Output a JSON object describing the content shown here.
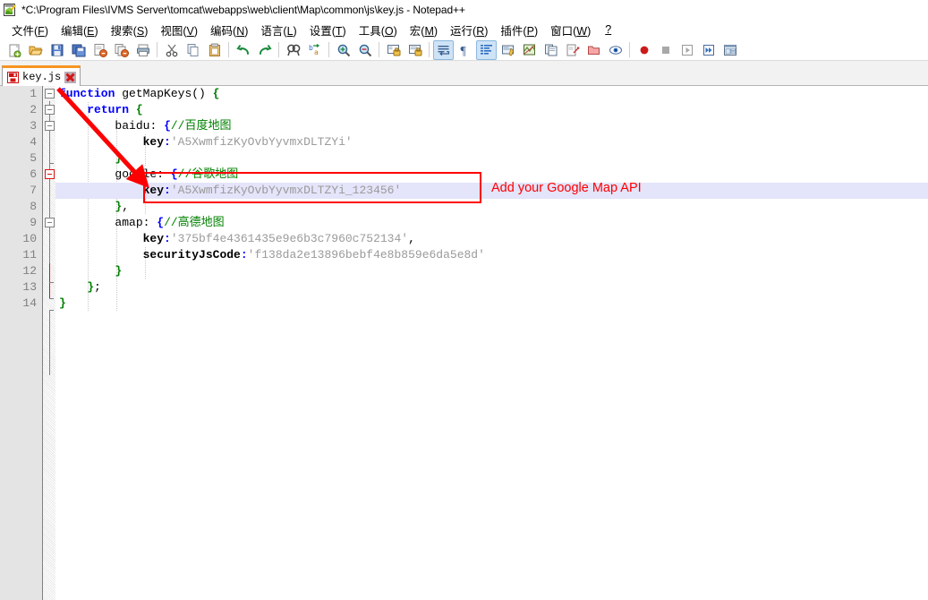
{
  "window": {
    "title": "*C:\\Program Files\\IVMS Server\\tomcat\\webapps\\web\\client\\Map\\common\\js\\key.js - Notepad++",
    "app_icon": "notepad-plus-plus-icon"
  },
  "menubar": {
    "items": [
      {
        "label": "文件(F)",
        "name": "menu-file"
      },
      {
        "label": "编辑(E)",
        "name": "menu-edit"
      },
      {
        "label": "搜索(S)",
        "name": "menu-search"
      },
      {
        "label": "视图(V)",
        "name": "menu-view"
      },
      {
        "label": "编码(N)",
        "name": "menu-encoding"
      },
      {
        "label": "语言(L)",
        "name": "menu-language"
      },
      {
        "label": "设置(T)",
        "name": "menu-settings"
      },
      {
        "label": "工具(O)",
        "name": "menu-tools"
      },
      {
        "label": "宏(M)",
        "name": "menu-macro"
      },
      {
        "label": "运行(R)",
        "name": "menu-run"
      },
      {
        "label": "插件(P)",
        "name": "menu-plugins"
      },
      {
        "label": "窗口(W)",
        "name": "menu-window"
      },
      {
        "label": "?",
        "name": "menu-help"
      }
    ]
  },
  "toolbar": {
    "buttons": [
      {
        "icon": "new-file-icon",
        "active": false,
        "sep_after": false
      },
      {
        "icon": "open-file-icon",
        "active": false,
        "sep_after": false
      },
      {
        "icon": "save-icon",
        "active": false,
        "sep_after": false
      },
      {
        "icon": "save-all-icon",
        "active": false,
        "sep_after": false
      },
      {
        "icon": "close-file-icon",
        "active": false,
        "sep_after": false
      },
      {
        "icon": "close-all-files-icon",
        "active": false,
        "sep_after": false
      },
      {
        "icon": "print-icon",
        "active": false,
        "sep_after": true
      },
      {
        "icon": "cut-icon",
        "active": false,
        "sep_after": false
      },
      {
        "icon": "copy-icon",
        "active": false,
        "sep_after": false
      },
      {
        "icon": "paste-icon",
        "active": false,
        "sep_after": true
      },
      {
        "icon": "undo-icon",
        "active": false,
        "sep_after": false
      },
      {
        "icon": "redo-icon",
        "active": false,
        "sep_after": true
      },
      {
        "icon": "find-icon",
        "active": false,
        "sep_after": false
      },
      {
        "icon": "replace-icon",
        "active": false,
        "sep_after": true
      },
      {
        "icon": "zoom-in-icon",
        "active": false,
        "sep_after": false
      },
      {
        "icon": "zoom-out-icon",
        "active": false,
        "sep_after": true
      },
      {
        "icon": "sync-vertical-scroll-icon",
        "active": false,
        "sep_after": false
      },
      {
        "icon": "sync-horizontal-scroll-icon",
        "active": false,
        "sep_after": true
      },
      {
        "icon": "word-wrap-icon",
        "active": true,
        "sep_after": false
      },
      {
        "icon": "show-all-characters-icon",
        "active": false,
        "sep_after": false
      },
      {
        "icon": "indent-guideline-icon",
        "active": true,
        "sep_after": false
      },
      {
        "icon": "user-defined-language-icon",
        "active": false,
        "sep_after": false
      },
      {
        "icon": "document-map-icon",
        "active": false,
        "sep_after": false
      },
      {
        "icon": "function-list-icon",
        "active": false,
        "sep_after": false
      },
      {
        "icon": "file-browser-icon",
        "active": false,
        "sep_after": false
      },
      {
        "icon": "folder-as-workspace-icon",
        "active": false,
        "sep_after": false
      },
      {
        "icon": "monitoring-icon",
        "active": false,
        "sep_after": true
      },
      {
        "icon": "record-macro-icon",
        "active": false,
        "sep_after": false
      },
      {
        "icon": "stop-macro-icon",
        "active": false,
        "sep_after": false
      },
      {
        "icon": "play-macro-icon",
        "active": false,
        "sep_after": false
      },
      {
        "icon": "run-macro-multiple-icon",
        "active": false,
        "sep_after": false
      },
      {
        "icon": "save-macro-icon",
        "active": false,
        "sep_after": false
      }
    ]
  },
  "tabs": [
    {
      "label": "key.js",
      "modified": true,
      "active": true,
      "icon": "unsaved-file-icon"
    }
  ],
  "editor": {
    "line_numbers": [
      "1",
      "2",
      "3",
      "4",
      "5",
      "6",
      "7",
      "8",
      "9",
      "10",
      "11",
      "12",
      "13",
      "14"
    ],
    "highlighted_line": 7,
    "lines": [
      {
        "n": 1,
        "tokens": [
          {
            "t": "function",
            "c": "kw"
          },
          {
            "t": " ",
            "c": "punc"
          },
          {
            "t": "getMapKeys",
            "c": "id"
          },
          {
            "t": "()",
            "c": "punc"
          },
          {
            "t": " ",
            "c": "punc"
          },
          {
            "t": "{",
            "c": "brc"
          }
        ]
      },
      {
        "n": 2,
        "tokens": [
          {
            "t": "    ",
            "c": "punc"
          },
          {
            "t": "return",
            "c": "kw"
          },
          {
            "t": " ",
            "c": "punc"
          },
          {
            "t": "{",
            "c": "brc"
          }
        ]
      },
      {
        "n": 3,
        "tokens": [
          {
            "t": "        ",
            "c": "punc"
          },
          {
            "t": "baidu",
            "c": "id"
          },
          {
            "t": ":",
            "c": "punc"
          },
          {
            "t": " ",
            "c": "punc"
          },
          {
            "t": "{",
            "c": "brcb"
          },
          {
            "t": "//百度地图",
            "c": "cmt"
          }
        ]
      },
      {
        "n": 4,
        "tokens": [
          {
            "t": "            ",
            "c": "punc"
          },
          {
            "t": "key",
            "c": "prop"
          },
          {
            "t": ":",
            "c": "colon"
          },
          {
            "t": "'A5XwmfizKyOvbYyvmxDLTZYi'",
            "c": "str"
          }
        ]
      },
      {
        "n": 5,
        "tokens": [
          {
            "t": "        ",
            "c": "punc"
          },
          {
            "t": "}",
            "c": "brc"
          },
          {
            "t": ",",
            "c": "punc"
          }
        ]
      },
      {
        "n": 6,
        "tokens": [
          {
            "t": "        ",
            "c": "punc"
          },
          {
            "t": "google",
            "c": "id"
          },
          {
            "t": ":",
            "c": "punc"
          },
          {
            "t": " ",
            "c": "punc"
          },
          {
            "t": "{",
            "c": "brcb"
          },
          {
            "t": "//谷歌地图",
            "c": "cmt"
          }
        ]
      },
      {
        "n": 7,
        "tokens": [
          {
            "t": "            ",
            "c": "punc"
          },
          {
            "t": "key",
            "c": "prop"
          },
          {
            "t": ":",
            "c": "colon"
          },
          {
            "t": "'A5XwmfizKyOvbYyvmxDLTZYi_123456'",
            "c": "str"
          }
        ]
      },
      {
        "n": 8,
        "tokens": [
          {
            "t": "        ",
            "c": "punc"
          },
          {
            "t": "}",
            "c": "brc"
          },
          {
            "t": ",",
            "c": "punc"
          }
        ]
      },
      {
        "n": 9,
        "tokens": [
          {
            "t": "        ",
            "c": "punc"
          },
          {
            "t": "amap",
            "c": "id"
          },
          {
            "t": ":",
            "c": "punc"
          },
          {
            "t": " ",
            "c": "punc"
          },
          {
            "t": "{",
            "c": "brcb"
          },
          {
            "t": "//高德地图",
            "c": "cmt"
          }
        ]
      },
      {
        "n": 10,
        "tokens": [
          {
            "t": "            ",
            "c": "punc"
          },
          {
            "t": "key",
            "c": "prop"
          },
          {
            "t": ":",
            "c": "colon"
          },
          {
            "t": "'375bf4e4361435e9e6b3c7960c752134'",
            "c": "str"
          },
          {
            "t": ",",
            "c": "punc"
          }
        ]
      },
      {
        "n": 11,
        "tokens": [
          {
            "t": "            ",
            "c": "punc"
          },
          {
            "t": "securityJsCode",
            "c": "prop"
          },
          {
            "t": ":",
            "c": "colon"
          },
          {
            "t": "'f138da2e13896bebf4e8b859e6da5e8d'",
            "c": "str"
          }
        ]
      },
      {
        "n": 12,
        "tokens": [
          {
            "t": "        ",
            "c": "punc"
          },
          {
            "t": "}",
            "c": "brc"
          }
        ]
      },
      {
        "n": 13,
        "tokens": [
          {
            "t": "    ",
            "c": "punc"
          },
          {
            "t": "}",
            "c": "brc"
          },
          {
            "t": ";",
            "c": "punc"
          }
        ]
      },
      {
        "n": 14,
        "tokens": [
          {
            "t": "}",
            "c": "brc"
          }
        ]
      }
    ]
  },
  "annotations": {
    "callout_text": "Add your Google Map API",
    "callout_color": "#fe0000",
    "arrow_color": "#fe0000",
    "box_color": "#fe0000"
  }
}
